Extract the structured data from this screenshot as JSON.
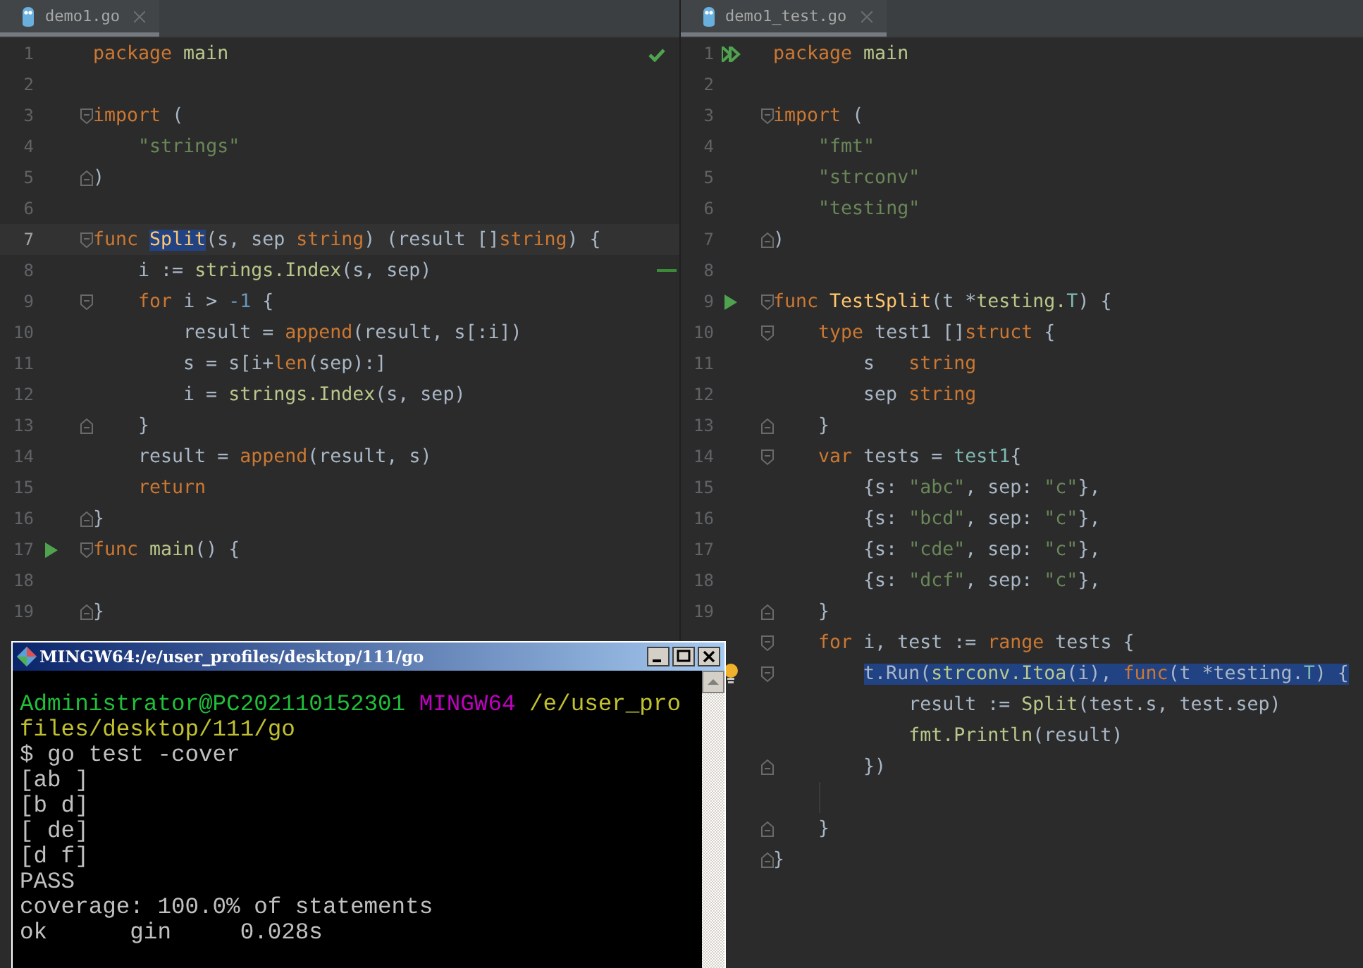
{
  "panes": [
    {
      "tab": {
        "label": "demo1.go",
        "selected": true
      },
      "status_ok": true,
      "lines": [
        {
          "num": "1",
          "tokens": [
            {
              "kind": "kw",
              "text": "package "
            },
            {
              "kind": "pkg",
              "text": "main"
            }
          ]
        },
        {
          "num": "2"
        },
        {
          "num": "3",
          "fold_marker": {
            "kind": "start"
          },
          "tokens": [
            {
              "kind": "kw",
              "text": "import"
            },
            {
              "kind": "plain",
              "text": " ("
            }
          ]
        },
        {
          "num": "4",
          "tokens": [
            {
              "kind": "str",
              "text": "    \"strings\""
            }
          ]
        },
        {
          "num": "5",
          "fold_marker": {
            "kind": "end"
          },
          "tokens": [
            {
              "kind": "plain",
              "text": ")"
            }
          ]
        },
        {
          "num": "6"
        },
        {
          "num": "7",
          "fold_marker": {
            "kind": "start"
          },
          "current": true,
          "tokens": [
            {
              "kind": "kw",
              "text": "func "
            },
            {
              "kind": "fn",
              "text": "Split",
              "selected": true
            },
            {
              "kind": "plain",
              "text": "(s, sep "
            },
            {
              "kind": "kw",
              "text": "string"
            },
            {
              "kind": "plain",
              "text": ") (result []"
            },
            {
              "kind": "kw",
              "text": "string"
            },
            {
              "kind": "plain",
              "text": ") {"
            }
          ]
        },
        {
          "num": "8",
          "change": true,
          "tokens": [
            {
              "kind": "plain",
              "text": "    i := "
            },
            {
              "kind": "call",
              "text": "strings.Index"
            },
            {
              "kind": "plain",
              "text": "(s, sep)"
            }
          ]
        },
        {
          "num": "9",
          "fold_marker": {
            "kind": "start"
          },
          "tokens": [
            {
              "kind": "kw",
              "text": "    for "
            },
            {
              "kind": "plain",
              "text": "i > "
            },
            {
              "kind": "num",
              "text": "-1"
            },
            {
              "kind": "plain",
              "text": " {"
            }
          ]
        },
        {
          "num": "10",
          "tokens": [
            {
              "kind": "plain",
              "text": "        result = "
            },
            {
              "kind": "builtin",
              "text": "append"
            },
            {
              "kind": "plain",
              "text": "(result, s[:i])"
            }
          ]
        },
        {
          "num": "11",
          "tokens": [
            {
              "kind": "plain",
              "text": "        s = s[i+"
            },
            {
              "kind": "builtin",
              "text": "len"
            },
            {
              "kind": "plain",
              "text": "(sep):]"
            }
          ]
        },
        {
          "num": "12",
          "tokens": [
            {
              "kind": "plain",
              "text": "        i = "
            },
            {
              "kind": "call",
              "text": "strings.Index"
            },
            {
              "kind": "plain",
              "text": "(s, sep)"
            }
          ]
        },
        {
          "num": "13",
          "fold_marker": {
            "kind": "end"
          },
          "tokens": [
            {
              "kind": "plain",
              "text": "    }"
            }
          ]
        },
        {
          "num": "14",
          "tokens": [
            {
              "kind": "plain",
              "text": "    result = "
            },
            {
              "kind": "builtin",
              "text": "append"
            },
            {
              "kind": "plain",
              "text": "(result, s)"
            }
          ]
        },
        {
          "num": "15",
          "tokens": [
            {
              "kind": "kw",
              "text": "    return"
            }
          ]
        },
        {
          "num": "16",
          "fold_marker": {
            "kind": "end"
          },
          "tokens": [
            {
              "kind": "plain",
              "text": "}"
            }
          ]
        },
        {
          "num": "17",
          "gutter_icon": {
            "kind": "run"
          },
          "fold_marker": {
            "kind": "start"
          },
          "tokens": [
            {
              "kind": "kw",
              "text": "func "
            },
            {
              "kind": "pkg",
              "text": "main"
            },
            {
              "kind": "plain",
              "text": "() {"
            }
          ]
        },
        {
          "num": "18"
        },
        {
          "num": "19",
          "fold_marker": {
            "kind": "end"
          },
          "tokens": [
            {
              "kind": "plain",
              "text": "}"
            }
          ]
        }
      ]
    },
    {
      "tab": {
        "label": "demo1_test.go",
        "selected": true
      },
      "lines": [
        {
          "num": "1",
          "gutter_icon": {
            "kind": "run-all"
          },
          "tokens": [
            {
              "kind": "kw",
              "text": "package "
            },
            {
              "kind": "pkg",
              "text": "main"
            }
          ]
        },
        {
          "num": "2"
        },
        {
          "num": "3",
          "fold_marker": {
            "kind": "start"
          },
          "tokens": [
            {
              "kind": "kw",
              "text": "import"
            },
            {
              "kind": "plain",
              "text": " ("
            }
          ]
        },
        {
          "num": "4",
          "tokens": [
            {
              "kind": "str",
              "text": "    \"fmt\""
            }
          ]
        },
        {
          "num": "5",
          "tokens": [
            {
              "kind": "str",
              "text": "    \"strconv\""
            }
          ]
        },
        {
          "num": "6",
          "tokens": [
            {
              "kind": "str",
              "text": "    \"testing\""
            }
          ]
        },
        {
          "num": "7",
          "fold_marker": {
            "kind": "end"
          },
          "tokens": [
            {
              "kind": "plain",
              "text": ")"
            }
          ]
        },
        {
          "num": "8"
        },
        {
          "num": "9",
          "gutter_icon": {
            "kind": "run"
          },
          "fold_marker": {
            "kind": "start"
          },
          "tokens": [
            {
              "kind": "kw",
              "text": "func "
            },
            {
              "kind": "fn",
              "text": "TestSplit"
            },
            {
              "kind": "plain",
              "text": "(t *"
            },
            {
              "kind": "call",
              "text": "testing."
            },
            {
              "kind": "type",
              "text": "T"
            },
            {
              "kind": "plain",
              "text": ") {"
            }
          ]
        },
        {
          "num": "10",
          "fold_marker": {
            "kind": "start"
          },
          "tokens": [
            {
              "kind": "kw",
              "text": "    type "
            },
            {
              "kind": "plain",
              "text": "test1 []"
            },
            {
              "kind": "kw",
              "text": "struct"
            },
            {
              "kind": "plain",
              "text": " {"
            }
          ]
        },
        {
          "num": "11",
          "tokens": [
            {
              "kind": "plain",
              "text": "        s   "
            },
            {
              "kind": "kw",
              "text": "string"
            }
          ]
        },
        {
          "num": "12",
          "tokens": [
            {
              "kind": "plain",
              "text": "        sep "
            },
            {
              "kind": "kw",
              "text": "string"
            }
          ]
        },
        {
          "num": "13",
          "fold_marker": {
            "kind": "end"
          },
          "tokens": [
            {
              "kind": "plain",
              "text": "    }"
            }
          ]
        },
        {
          "num": "14",
          "fold_marker": {
            "kind": "start"
          },
          "tokens": [
            {
              "kind": "kw",
              "text": "    var "
            },
            {
              "kind": "plain",
              "text": "tests = "
            },
            {
              "kind": "type",
              "text": "test1"
            },
            {
              "kind": "plain",
              "text": "{"
            }
          ]
        },
        {
          "num": "15",
          "tokens": [
            {
              "kind": "plain",
              "text": "        {s: "
            },
            {
              "kind": "str",
              "text": "\"abc\""
            },
            {
              "kind": "plain",
              "text": ", sep: "
            },
            {
              "kind": "str",
              "text": "\"c\""
            },
            {
              "kind": "plain",
              "text": "},"
            }
          ]
        },
        {
          "num": "16",
          "tokens": [
            {
              "kind": "plain",
              "text": "        {s: "
            },
            {
              "kind": "str",
              "text": "\"bcd\""
            },
            {
              "kind": "plain",
              "text": ", sep: "
            },
            {
              "kind": "str",
              "text": "\"c\""
            },
            {
              "kind": "plain",
              "text": "},"
            }
          ]
        },
        {
          "num": "17",
          "tokens": [
            {
              "kind": "plain",
              "text": "        {s: "
            },
            {
              "kind": "str",
              "text": "\"cde\""
            },
            {
              "kind": "plain",
              "text": ", sep: "
            },
            {
              "kind": "str",
              "text": "\"c\""
            },
            {
              "kind": "plain",
              "text": "},"
            }
          ]
        },
        {
          "num": "18",
          "tokens": [
            {
              "kind": "plain",
              "text": "        {s: "
            },
            {
              "kind": "str",
              "text": "\"dcf\""
            },
            {
              "kind": "plain",
              "text": ", sep: "
            },
            {
              "kind": "str",
              "text": "\"c\""
            },
            {
              "kind": "plain",
              "text": "},"
            }
          ]
        },
        {
          "num": "19",
          "fold_marker": {
            "kind": "end"
          },
          "tokens": [
            {
              "kind": "plain",
              "text": "    }"
            }
          ]
        },
        {
          "fold_marker": {
            "kind": "start"
          },
          "tokens": [
            {
              "kind": "kw",
              "text": "    for "
            },
            {
              "kind": "plain",
              "text": "i, test := "
            },
            {
              "kind": "kw",
              "text": "range "
            },
            {
              "kind": "plain",
              "text": "tests {"
            }
          ]
        },
        {
          "gutter_icon": {
            "kind": "bulb"
          },
          "fold_marker": {
            "kind": "start"
          },
          "tokens": [
            {
              "kind": "plain",
              "text": "        t.Run(",
              "selected": true
            },
            {
              "kind": "call",
              "text": "strconv.Itoa",
              "selected": true
            },
            {
              "kind": "plain",
              "text": "(i), ",
              "selected": true
            },
            {
              "kind": "kw",
              "text": "func",
              "selected": true
            },
            {
              "kind": "plain",
              "text": "(t *testing.",
              "selected": true
            },
            {
              "kind": "type",
              "text": "T",
              "selected": true
            },
            {
              "kind": "plain",
              "text": ") {",
              "selected": true
            }
          ]
        },
        {
          "tokens": [
            {
              "kind": "plain",
              "text": "            result := "
            },
            {
              "kind": "call",
              "text": "Split"
            },
            {
              "kind": "plain",
              "text": "(test.s, test.sep)"
            }
          ]
        },
        {
          "tokens": [
            {
              "kind": "call",
              "text": "            fmt.Println"
            },
            {
              "kind": "plain",
              "text": "(result)"
            }
          ]
        },
        {
          "fold_marker": {
            "kind": "end"
          },
          "tokens": [
            {
              "kind": "plain",
              "text": "        })"
            }
          ]
        },
        {
          "kind": "blank"
        },
        {
          "fold_marker": {
            "kind": "end"
          },
          "tokens": [
            {
              "kind": "plain",
              "text": "    }"
            }
          ]
        },
        {
          "fold_marker": {
            "kind": "end"
          },
          "tokens": [
            {
              "kind": "plain",
              "text": "}"
            }
          ]
        }
      ]
    }
  ],
  "terminal": {
    "title": "MINGW64:/e/user_profiles/desktop/111/go",
    "lines": [
      {
        "segments": [
          {
            "kind": "user",
            "text": "Administrator@PC202110152301 "
          },
          {
            "kind": "host",
            "text": "MINGW64 "
          },
          {
            "kind": "path",
            "text": "/e/user_pro"
          }
        ]
      },
      {
        "segments": [
          {
            "kind": "path",
            "text": "files/desktop/111/go"
          }
        ]
      },
      {
        "segments": [
          {
            "kind": "plain",
            "text": "$ go test -cover"
          }
        ]
      },
      {
        "segments": [
          {
            "kind": "plain",
            "text": "[ab ]"
          }
        ]
      },
      {
        "segments": [
          {
            "kind": "plain",
            "text": "[b d]"
          }
        ]
      },
      {
        "segments": [
          {
            "kind": "plain",
            "text": "[ de]"
          }
        ]
      },
      {
        "segments": [
          {
            "kind": "plain",
            "text": "[d f]"
          }
        ]
      },
      {
        "segments": [
          {
            "kind": "plain",
            "text": "PASS"
          }
        ]
      },
      {
        "segments": [
          {
            "kind": "plain",
            "text": "coverage: 100.0% of statements"
          }
        ]
      },
      {
        "segments": [
          {
            "kind": "plain",
            "text": "ok      gin     0.028s"
          }
        ]
      }
    ]
  }
}
